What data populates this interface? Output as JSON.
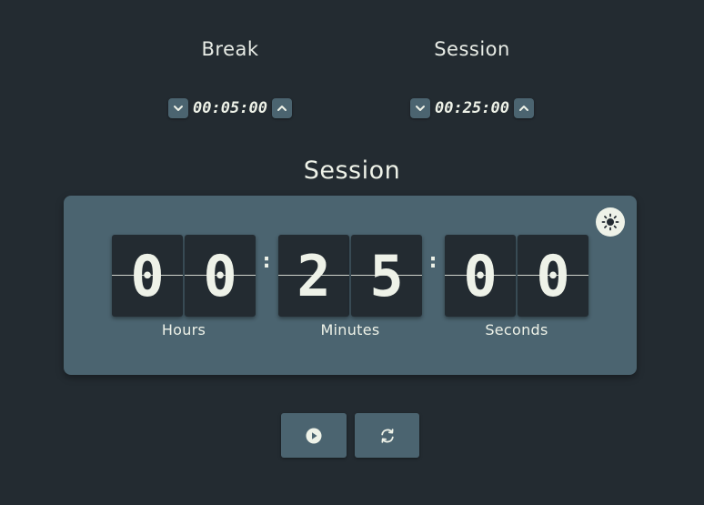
{
  "break": {
    "title": "Break",
    "value": "00:05:00",
    "decrement_icon": "chevron-down-icon",
    "increment_icon": "chevron-up-icon"
  },
  "session": {
    "title": "Session",
    "value": "00:25:00",
    "decrement_icon": "chevron-down-icon",
    "increment_icon": "chevron-up-icon"
  },
  "timer": {
    "label": "Session",
    "hours": [
      "0",
      "0"
    ],
    "minutes": [
      "2",
      "5"
    ],
    "seconds": [
      "0",
      "0"
    ],
    "separator": ":",
    "units": {
      "hours": "Hours",
      "minutes": "Minutes",
      "seconds": "Seconds"
    },
    "theme_icon": "sun-icon"
  },
  "controls": {
    "play_icon": "play-icon",
    "reset_icon": "refresh-icon"
  },
  "colors": {
    "background": "#232b31",
    "panel": "#4b6470",
    "text": "#eef2e8"
  }
}
